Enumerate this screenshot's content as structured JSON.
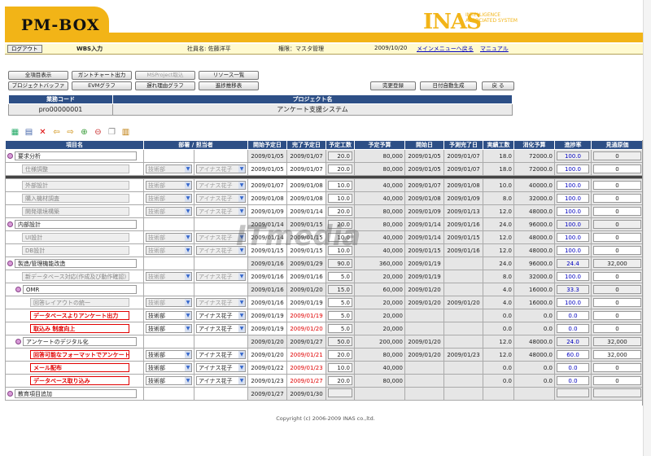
{
  "header": {
    "logo": "PM-BOX",
    "brand_main": "INAS",
    "brand_sub": "INTELLIGENCE ASSOCIATED SYSTEM"
  },
  "infobar": {
    "logout": "ログアウト",
    "screen": "WBS入力",
    "employee": "社員名: 佐藤洋平",
    "role": "権限：マスタ管理",
    "date": "2009/10/20",
    "main_menu": "メインメニューへ戻る",
    "manual": "マニュアル"
  },
  "buttons": {
    "all": "全項目表示",
    "gantt": "ガントチャート出力",
    "msproject": "MSProject取込",
    "resources": "リソース一覧",
    "buffer": "プロジェクトバッファ",
    "evm": "EVMグラフ",
    "delay": "遅れ理由グラフ",
    "progress": "進捗推移表",
    "confirm": "完更登録",
    "autodate": "日付自動生成",
    "back": "戻 る"
  },
  "project": {
    "code_header": "業務コード",
    "name_header": "プロジェクト名",
    "code": "pro00000001",
    "name": "アンケート支援システム"
  },
  "toolbar_icons": [
    "grid-icon",
    "save-icon",
    "delete-icon",
    "arrow-left-icon",
    "arrow-right-icon",
    "zoom-in-icon",
    "zoom-out-icon",
    "copy-icon",
    "paste-icon"
  ],
  "columns": [
    "項目名",
    "部署 / 担当者",
    "開始予定日",
    "完了予定日",
    "予定工数",
    "予定予算",
    "開始日",
    "予測完了日",
    "実績工数",
    "消化予算",
    "進捗率",
    "見通原価"
  ],
  "rows": [
    {
      "name": "要求分析",
      "indent": 0,
      "marker": true,
      "dim": false,
      "bold": false,
      "dept": "",
      "person": "",
      "start": "2009/01/05",
      "end": "2009/01/07",
      "hours": "20.0",
      "budget": "80,000",
      "astart": "2009/01/05",
      "pend": "2009/01/07",
      "ahours": "18.0",
      "spent": "72000.0",
      "prog": "100.0",
      "cost": "0",
      "endred": false,
      "w": false
    },
    {
      "name": "仕様調整",
      "indent": 1,
      "marker": false,
      "dim": true,
      "bold": false,
      "dept": "技術部",
      "person": "アイナス花子",
      "start": "2009/01/05",
      "end": "2009/01/07",
      "hours": "20.0",
      "budget": "80,000",
      "astart": "2009/01/05",
      "pend": "2009/01/07",
      "ahours": "18.0",
      "spent": "72000.0",
      "prog": "100.0",
      "cost": "0",
      "endred": false,
      "w": true
    },
    {
      "sep": true
    },
    {
      "name": "外部設計",
      "indent": 1,
      "marker": false,
      "dim": true,
      "bold": false,
      "dept": "技術部",
      "person": "アイナス花子",
      "start": "2009/01/07",
      "end": "2009/01/08",
      "hours": "10.0",
      "budget": "40,000",
      "astart": "2009/01/07",
      "pend": "2009/01/08",
      "ahours": "10.0",
      "spent": "40000.0",
      "prog": "100.0",
      "cost": "0",
      "endred": false,
      "w": true
    },
    {
      "name": "購入機材調査",
      "indent": 1,
      "marker": false,
      "dim": true,
      "bold": false,
      "dept": "技術部",
      "person": "アイナス花子",
      "start": "2009/01/08",
      "end": "2009/01/08",
      "hours": "10.0",
      "budget": "40,000",
      "astart": "2009/01/08",
      "pend": "2009/01/09",
      "ahours": "8.0",
      "spent": "32000.0",
      "prog": "100.0",
      "cost": "0",
      "endred": false,
      "w": true
    },
    {
      "name": "開発環境構築",
      "indent": 1,
      "marker": false,
      "dim": true,
      "bold": false,
      "dept": "技術部",
      "person": "アイナス花子",
      "start": "2009/01/09",
      "end": "2009/01/14",
      "hours": "20.0",
      "budget": "80,000",
      "astart": "2009/01/09",
      "pend": "2009/01/13",
      "ahours": "12.0",
      "spent": "48000.0",
      "prog": "100.0",
      "cost": "0",
      "endred": false,
      "w": true
    },
    {
      "name": "内部設計",
      "indent": 0,
      "marker": true,
      "dim": false,
      "bold": false,
      "dept": "",
      "person": "",
      "start": "2009/01/14",
      "end": "2009/01/15",
      "hours": "20.0",
      "budget": "80,000",
      "astart": "2009/01/14",
      "pend": "2009/01/16",
      "ahours": "24.0",
      "spent": "96000.0",
      "prog": "100.0",
      "cost": "0",
      "endred": false,
      "w": false
    },
    {
      "name": "UI設計",
      "indent": 1,
      "marker": false,
      "dim": true,
      "bold": false,
      "dept": "技術部",
      "person": "アイナス花子",
      "start": "2009/01/14",
      "end": "2009/01/15",
      "hours": "10.0",
      "budget": "40,000",
      "astart": "2009/01/14",
      "pend": "2009/01/15",
      "ahours": "12.0",
      "spent": "48000.0",
      "prog": "100.0",
      "cost": "0",
      "endred": false,
      "w": true
    },
    {
      "name": "DB設計",
      "indent": 1,
      "marker": false,
      "dim": true,
      "bold": false,
      "dept": "技術部",
      "person": "アイナス花子",
      "start": "2009/01/15",
      "end": "2009/01/15",
      "hours": "10.0",
      "budget": "40,000",
      "astart": "2009/01/15",
      "pend": "2009/01/16",
      "ahours": "12.0",
      "spent": "48000.0",
      "prog": "100.0",
      "cost": "0",
      "endred": false,
      "w": true
    },
    {
      "name": "製造/管理機能改造",
      "indent": 0,
      "marker": true,
      "dim": false,
      "bold": false,
      "dept": "",
      "person": "",
      "start": "2009/01/16",
      "end": "2009/01/29",
      "hours": "90.0",
      "budget": "360,000",
      "astart": "2009/01/19",
      "pend": "",
      "ahours": "24.0",
      "spent": "96000.0",
      "prog": "24.4",
      "cost": "32,000",
      "endred": false,
      "w": false
    },
    {
      "name": "新データベース対応(作成及び動作確認)",
      "indent": 1,
      "marker": false,
      "dim": true,
      "bold": false,
      "dept": "技術部",
      "person": "アイナス花子",
      "start": "2009/01/16",
      "end": "2009/01/16",
      "hours": "5.0",
      "budget": "20,000",
      "astart": "2009/01/19",
      "pend": "",
      "ahours": "8.0",
      "spent": "32000.0",
      "prog": "100.0",
      "cost": "0",
      "endred": false,
      "w": true
    },
    {
      "name": "OMR",
      "indent": 1,
      "marker": true,
      "dim": false,
      "bold": false,
      "dept": "",
      "person": "",
      "start": "2009/01/16",
      "end": "2009/01/20",
      "hours": "15.0",
      "budget": "60,000",
      "astart": "2009/01/20",
      "pend": "",
      "ahours": "4.0",
      "spent": "16000.0",
      "prog": "33.3",
      "cost": "0",
      "endred": false,
      "w": false
    },
    {
      "name": "回答レイアウトの統一",
      "indent": 2,
      "marker": false,
      "dim": true,
      "bold": false,
      "dept": "技術部",
      "person": "アイナス花子",
      "start": "2009/01/16",
      "end": "2009/01/19",
      "hours": "5.0",
      "budget": "20,000",
      "astart": "2009/01/20",
      "pend": "2009/01/20",
      "ahours": "4.0",
      "spent": "16000.0",
      "prog": "100.0",
      "cost": "0",
      "endred": false,
      "w": true
    },
    {
      "name": "データベースよりアンケート出力",
      "indent": 2,
      "marker": false,
      "dim": false,
      "bold": true,
      "dept": "技術部",
      "person": "アイナス花子",
      "start": "2009/01/19",
      "end": "2009/01/19",
      "hours": "5.0",
      "budget": "20,000",
      "astart": "",
      "pend": "",
      "ahours": "0.0",
      "spent": "0.0",
      "prog": "0.0",
      "cost": "0",
      "endred": true,
      "w": true
    },
    {
      "name": "取込み 制度向上",
      "indent": 2,
      "marker": false,
      "dim": false,
      "bold": true,
      "dept": "技術部",
      "person": "アイナス花子",
      "start": "2009/01/19",
      "end": "2009/01/20",
      "hours": "5.0",
      "budget": "20,000",
      "astart": "",
      "pend": "",
      "ahours": "0.0",
      "spent": "0.0",
      "prog": "0.0",
      "cost": "0",
      "endred": true,
      "w": true
    },
    {
      "name": "アンケートのデジタル化",
      "indent": 1,
      "marker": true,
      "dim": false,
      "bold": false,
      "dept": "",
      "person": "",
      "start": "2009/01/20",
      "end": "2009/01/27",
      "hours": "50.0",
      "budget": "200,000",
      "astart": "2009/01/20",
      "pend": "",
      "ahours": "12.0",
      "spent": "48000.0",
      "prog": "24.0",
      "cost": "32,000",
      "endred": false,
      "w": false
    },
    {
      "name": "回答可能なフォーマットでアンケート出",
      "indent": 2,
      "marker": false,
      "dim": false,
      "bold": true,
      "dept": "技術部",
      "person": "アイナス花子",
      "start": "2009/01/20",
      "end": "2009/01/21",
      "hours": "20.0",
      "budget": "80,000",
      "astart": "2009/01/20",
      "pend": "2009/01/23",
      "ahours": "12.0",
      "spent": "48000.0",
      "prog": "60.0",
      "cost": "32,000",
      "endred": true,
      "w": true
    },
    {
      "name": "メール配布",
      "indent": 2,
      "marker": false,
      "dim": false,
      "bold": true,
      "dept": "技術部",
      "person": "アイナス花子",
      "start": "2009/01/22",
      "end": "2009/01/23",
      "hours": "10.0",
      "budget": "40,000",
      "astart": "",
      "pend": "",
      "ahours": "0.0",
      "spent": "0.0",
      "prog": "0.0",
      "cost": "0",
      "endred": true,
      "w": true
    },
    {
      "name": "データベース取り込み",
      "indent": 2,
      "marker": false,
      "dim": false,
      "bold": true,
      "dept": "技術部",
      "person": "アイナス花子",
      "start": "2009/01/23",
      "end": "2009/01/27",
      "hours": "20.0",
      "budget": "80,000",
      "astart": "",
      "pend": "",
      "ahours": "0.0",
      "spent": "0.0",
      "prog": "0.0",
      "cost": "0",
      "endred": true,
      "w": true
    },
    {
      "name": "教育項目追加",
      "indent": 0,
      "marker": true,
      "dim": false,
      "bold": false,
      "dept": "",
      "person": "",
      "start": "2009/01/27",
      "end": "2009/01/30",
      "hours": "",
      "budget": "",
      "astart": "",
      "pend": "",
      "ahours": "",
      "spent": "",
      "prog": "",
      "cost": "",
      "endred": false,
      "w": false
    }
  ],
  "footer": "Copyright (c) 2006-2009 INAS co.,ltd.",
  "watermark": "ITmedia"
}
